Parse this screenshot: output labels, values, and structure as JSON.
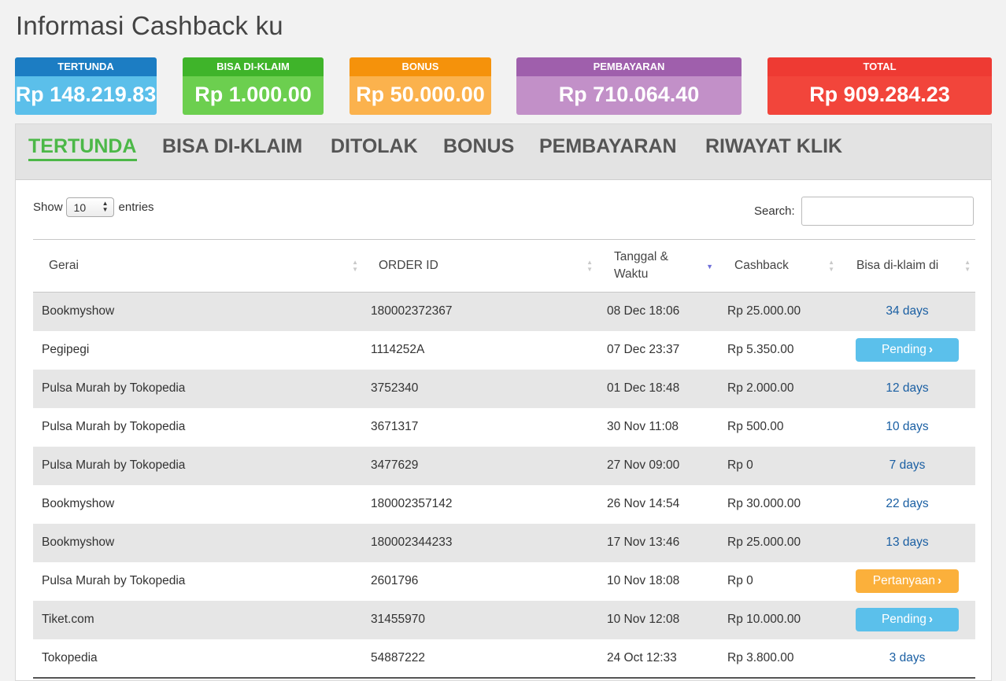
{
  "page": {
    "title": "Informasi Cashback ku"
  },
  "summary_cards": [
    {
      "label": "TERTUNDA",
      "value": "Rp 148.219.83",
      "header_color": "#1c7dc3",
      "body_color": "#5bbfea"
    },
    {
      "label": "BISA DI-KLAIM",
      "value": "Rp 1.000.00",
      "header_color": "#3fb42a",
      "body_color": "#6ccf4f"
    },
    {
      "label": "BONUS",
      "value": "Rp 50.000.00",
      "header_color": "#f5920b",
      "body_color": "#fbb24d"
    },
    {
      "label": "PEMBAYARAN",
      "value": "Rp 710.064.40",
      "header_color": "#9f5fac",
      "body_color": "#c290c8"
    },
    {
      "label": "TOTAL",
      "value": "Rp 909.284.23",
      "header_color": "#ee3a33",
      "body_color": "#f2453b"
    }
  ],
  "tabs": [
    {
      "label": "TERTUNDA",
      "active": true
    },
    {
      "label": "BISA DI-KLAIM",
      "active": false
    },
    {
      "label": "DITOLAK",
      "active": false
    },
    {
      "label": "BONUS",
      "active": false
    },
    {
      "label": "PEMBAYARAN",
      "active": false
    },
    {
      "label": "RIWAYAT KLIK",
      "active": false
    }
  ],
  "controls": {
    "show_label": "Show",
    "entries_value": "10",
    "entries_label": "entries",
    "search_label": "Search:",
    "search_value": ""
  },
  "table": {
    "columns": [
      "Gerai",
      "ORDER ID",
      "Tanggal & Waktu",
      "Cashback",
      "Bisa di-klaim di"
    ],
    "rows": [
      {
        "store": "Bookmyshow",
        "order_id": "180002372367",
        "datetime": "08 Dec 18:06",
        "cashback": "Rp 25.000.00",
        "claim": "34 days",
        "claim_type": "days"
      },
      {
        "store": "Pegipegi",
        "order_id": "1114252A",
        "datetime": "07 Dec 23:37",
        "cashback": "Rp 5.350.00",
        "claim": "Pending",
        "claim_type": "pending"
      },
      {
        "store": "Pulsa Murah by Tokopedia",
        "order_id": "3752340",
        "datetime": "01 Dec 18:48",
        "cashback": "Rp 2.000.00",
        "claim": "12 days",
        "claim_type": "days"
      },
      {
        "store": "Pulsa Murah by Tokopedia",
        "order_id": "3671317",
        "datetime": "30 Nov 11:08",
        "cashback": "Rp 500.00",
        "claim": "10 days",
        "claim_type": "days"
      },
      {
        "store": "Pulsa Murah by Tokopedia",
        "order_id": "3477629",
        "datetime": "27 Nov 09:00",
        "cashback": "Rp 0",
        "claim": "7 days",
        "claim_type": "days"
      },
      {
        "store": "Bookmyshow",
        "order_id": "180002357142",
        "datetime": "26 Nov 14:54",
        "cashback": "Rp 30.000.00",
        "claim": "22 days",
        "claim_type": "days"
      },
      {
        "store": "Bookmyshow",
        "order_id": "180002344233",
        "datetime": "17 Nov 13:46",
        "cashback": "Rp 25.000.00",
        "claim": "13 days",
        "claim_type": "days"
      },
      {
        "store": "Pulsa Murah by Tokopedia",
        "order_id": "2601796",
        "datetime": "10 Nov 18:08",
        "cashback": "Rp 0",
        "claim": "Pertanyaan",
        "claim_type": "question"
      },
      {
        "store": "Tiket.com",
        "order_id": "31455970",
        "datetime": "10 Nov 12:08",
        "cashback": "Rp 10.000.00",
        "claim": "Pending",
        "claim_type": "pending"
      },
      {
        "store": "Tokopedia",
        "order_id": "54887222",
        "datetime": "24 Oct 12:33",
        "cashback": "Rp 3.800.00",
        "claim": "3 days",
        "claim_type": "days"
      }
    ]
  },
  "colors": {
    "tab_active": "#4cb848",
    "pending_button": "#5bc0eb",
    "question_button": "#fbb03b",
    "days_link": "#1a5fa3"
  }
}
